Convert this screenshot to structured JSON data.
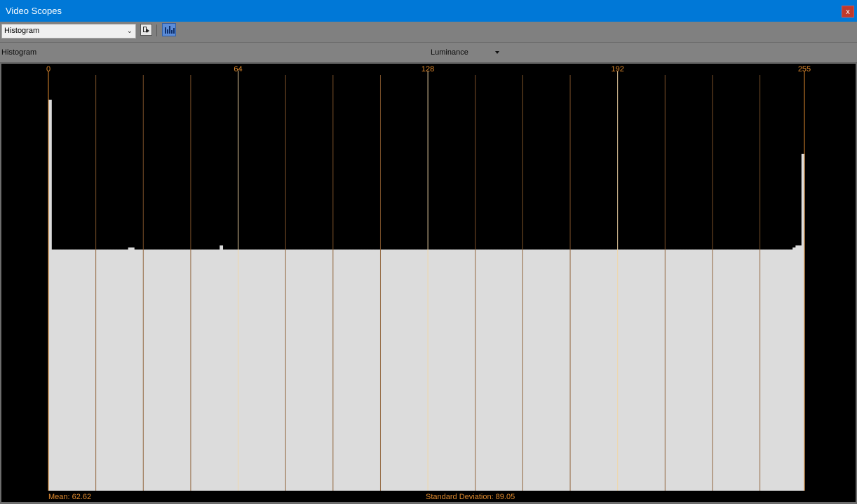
{
  "window": {
    "title": "Video Scopes",
    "close_label": "x"
  },
  "toolbar": {
    "scope_select_value": "Histogram",
    "buttons": [
      {
        "name": "pick-region",
        "icon": "select-region-icon"
      },
      {
        "name": "histogram-view",
        "icon": "histogram-icon",
        "active": true
      }
    ]
  },
  "subheader": {
    "label": "Histogram",
    "channel": "Luminance"
  },
  "colors": {
    "titlebar": "#0078d7",
    "scope_bg": "#000000",
    "bars": "#dcdcdc",
    "gridline": "#8a5a2e",
    "major_gridline": "#f2d7a8",
    "tick_text": "#e08a2e",
    "stats_text": "#e08a2e"
  },
  "stats": {
    "mean": "Mean: 62.62",
    "std": "Standard Deviation: 89.05"
  },
  "chart_data": {
    "type": "bar",
    "xlim": [
      0,
      255
    ],
    "ylim": [
      0,
      1
    ],
    "x_ticks": [
      "0",
      "64",
      "128",
      "192",
      "255"
    ],
    "x_tick_values": [
      0,
      64,
      128,
      192,
      255
    ],
    "minor_gridline_step": 16,
    "values_note": "",
    "values": [
      0.94,
      0.58,
      0.58,
      0.58,
      0.58,
      0.58,
      0.58,
      0.58,
      0.58,
      0.58,
      0.58,
      0.58,
      0.58,
      0.58,
      0.58,
      0.58,
      0.58,
      0.58,
      0.58,
      0.58,
      0.58,
      0.58,
      0.58,
      0.58,
      0.58,
      0.58,
      0.58,
      0.585,
      0.585,
      0.58,
      0.58,
      0.58,
      0.58,
      0.58,
      0.58,
      0.58,
      0.58,
      0.58,
      0.58,
      0.58,
      0.58,
      0.58,
      0.58,
      0.58,
      0.58,
      0.58,
      0.58,
      0.58,
      0.58,
      0.58,
      0.58,
      0.58,
      0.58,
      0.58,
      0.58,
      0.58,
      0.58,
      0.58,
      0.59,
      0.58,
      0.58,
      0.58,
      0.58,
      0.58,
      0.58,
      0.58,
      0.58,
      0.58,
      0.58,
      0.58,
      0.58,
      0.58,
      0.58,
      0.58,
      0.58,
      0.58,
      0.58,
      0.58,
      0.58,
      0.58,
      0.58,
      0.58,
      0.58,
      0.58,
      0.58,
      0.58,
      0.58,
      0.58,
      0.58,
      0.58,
      0.58,
      0.58,
      0.58,
      0.58,
      0.58,
      0.58,
      0.58,
      0.58,
      0.58,
      0.58,
      0.58,
      0.58,
      0.58,
      0.58,
      0.58,
      0.58,
      0.58,
      0.58,
      0.58,
      0.58,
      0.58,
      0.58,
      0.58,
      0.58,
      0.58,
      0.58,
      0.58,
      0.58,
      0.58,
      0.58,
      0.58,
      0.58,
      0.58,
      0.58,
      0.58,
      0.58,
      0.58,
      0.58,
      0.58,
      0.58,
      0.58,
      0.58,
      0.58,
      0.58,
      0.58,
      0.58,
      0.58,
      0.58,
      0.58,
      0.58,
      0.58,
      0.58,
      0.58,
      0.58,
      0.58,
      0.58,
      0.58,
      0.58,
      0.58,
      0.58,
      0.58,
      0.58,
      0.58,
      0.58,
      0.58,
      0.58,
      0.58,
      0.58,
      0.58,
      0.58,
      0.58,
      0.58,
      0.58,
      0.58,
      0.58,
      0.58,
      0.58,
      0.58,
      0.58,
      0.58,
      0.58,
      0.58,
      0.58,
      0.58,
      0.58,
      0.58,
      0.58,
      0.58,
      0.58,
      0.58,
      0.58,
      0.58,
      0.58,
      0.58,
      0.58,
      0.58,
      0.58,
      0.58,
      0.58,
      0.58,
      0.58,
      0.58,
      0.58,
      0.58,
      0.58,
      0.58,
      0.58,
      0.58,
      0.58,
      0.58,
      0.58,
      0.58,
      0.58,
      0.58,
      0.58,
      0.58,
      0.58,
      0.58,
      0.58,
      0.58,
      0.58,
      0.58,
      0.58,
      0.58,
      0.58,
      0.58,
      0.58,
      0.58,
      0.58,
      0.58,
      0.58,
      0.58,
      0.58,
      0.58,
      0.58,
      0.58,
      0.58,
      0.58,
      0.58,
      0.58,
      0.58,
      0.58,
      0.58,
      0.58,
      0.58,
      0.58,
      0.58,
      0.58,
      0.58,
      0.58,
      0.58,
      0.58,
      0.58,
      0.58,
      0.58,
      0.58,
      0.58,
      0.58,
      0.58,
      0.58,
      0.58,
      0.58,
      0.585,
      0.59,
      0.59,
      0.81
    ]
  }
}
